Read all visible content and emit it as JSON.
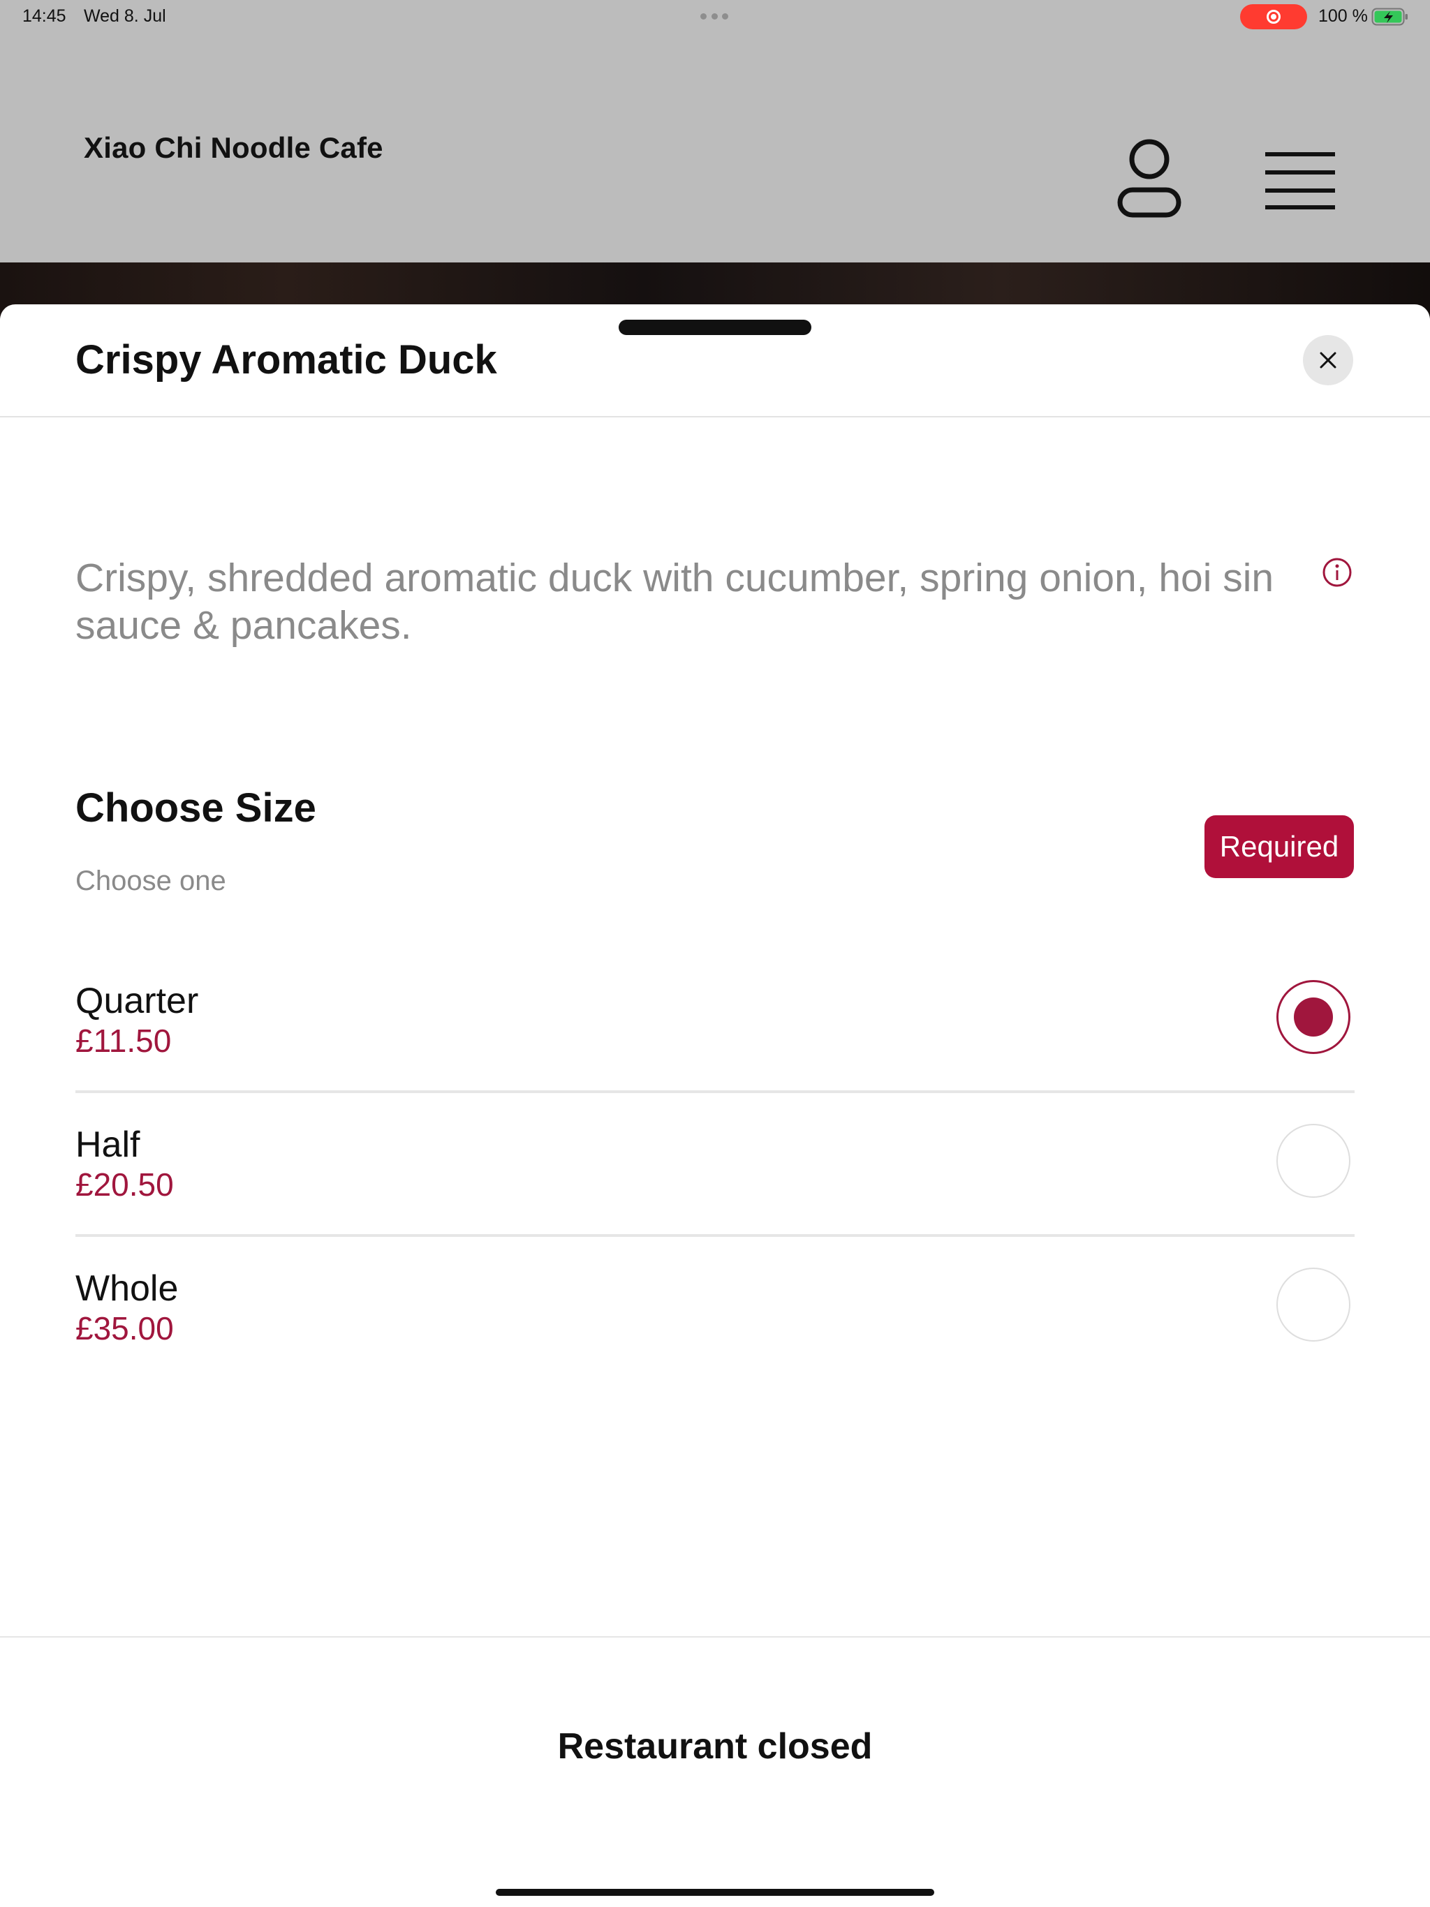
{
  "status_bar": {
    "time": "14:45",
    "date": "Wed 8. Jul",
    "battery": "100 %",
    "icons": [
      "multitask-dots-icon",
      "screen-recording-icon",
      "battery-charging-icon"
    ]
  },
  "header": {
    "restaurant_name": "Xiao Chi Noodle Cafe",
    "icons": [
      "profile-icon",
      "menu-icon"
    ]
  },
  "sheet": {
    "title": "Crispy Aromatic Duck",
    "description": "Crispy, shredded aromatic duck with cucumber, spring onion, hoi sin sauce & pancakes.",
    "icons": [
      "close-icon",
      "info-icon"
    ]
  },
  "size_group": {
    "title": "Choose Size",
    "subtitle": "Choose one",
    "badge": "Required",
    "options": [
      {
        "label": "Quarter",
        "price": "£11.50",
        "selected": true
      },
      {
        "label": "Half",
        "price": "£20.50",
        "selected": false
      },
      {
        "label": "Whole",
        "price": "£35.00",
        "selected": false
      }
    ]
  },
  "footer": {
    "status": "Restaurant closed"
  },
  "colors": {
    "accent": "#b0103a",
    "price": "#a0163d",
    "header_bg": "#bcbcbc",
    "muted_text": "#8a8a8a"
  }
}
